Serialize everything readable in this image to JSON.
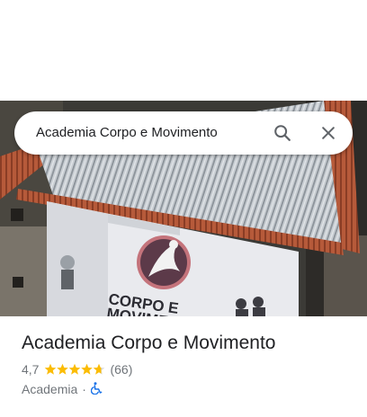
{
  "search": {
    "query": "Academia Corpo e Movimento"
  },
  "photo": {
    "banner_line1": "CORPO E",
    "banner_line2": "MOVIMENTO"
  },
  "place": {
    "title": "Academia Corpo e Movimento",
    "rating": "4,7",
    "rating_value": 4.7,
    "reviews": "(66)",
    "category": "Academia",
    "separator": "·",
    "accessibility_icon": "wheelchair-icon"
  },
  "colors": {
    "star": "#fbbc04",
    "star_empty": "#dadce0",
    "accessibility": "#1a73e8",
    "text_secondary": "#70757a"
  }
}
